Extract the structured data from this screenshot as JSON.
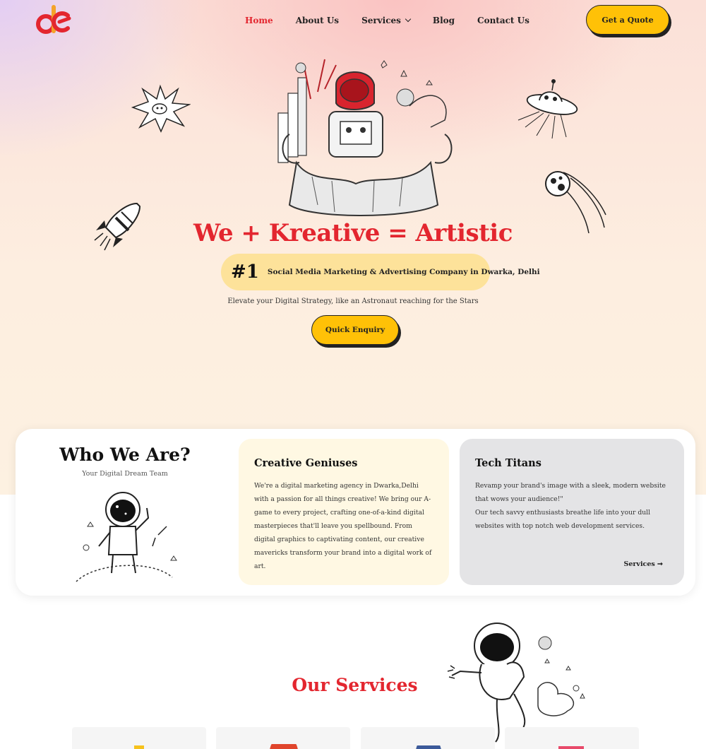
{
  "header": {
    "nav": [
      {
        "label": "Home",
        "active": true
      },
      {
        "label": "About Us"
      },
      {
        "label": "Services",
        "dropdown": true
      },
      {
        "label": "Blog"
      },
      {
        "label": "Contact Us"
      }
    ],
    "cta_label": "Get a Quote"
  },
  "hero": {
    "title": "We + Kreative = Artistic",
    "badge_number": "#1",
    "badge_text": "Social Media Marketing & Advertising Company in Dwarka, Delhi",
    "tagline": "Elevate your Digital Strategy, like an Astronaut reaching for the Stars",
    "button_label": "Quick Enquiry"
  },
  "about": {
    "title": "Who We Are?",
    "subtitle": "Your Digital Dream Team",
    "cards": [
      {
        "title": "Creative Geniuses",
        "text": "We're a digital marketing agency in Dwarka,Delhi with a passion for all things creative! We bring our A-game to every project, crafting one-of-a-kind digital masterpieces that'll leave you spellbound. From digital graphics to captivating content, our creative mavericks transform your brand into a digital work of art."
      },
      {
        "title": "Tech Titans",
        "text_1": "Revamp your brand's image with a sleek, modern website that wows your audience!\"",
        "text_2": "Our tech savvy enthusiasts breathe life into your dull websites with top notch web development services.",
        "link_label": "Services ➞"
      }
    ]
  },
  "services": {
    "title": "Our Services"
  },
  "colors": {
    "brand_red": "#e3262f",
    "accent_yellow": "#ffc107",
    "badge_bg": "#fde29a",
    "card_cream": "#fff8e3",
    "card_gray": "#e4e4e6"
  }
}
